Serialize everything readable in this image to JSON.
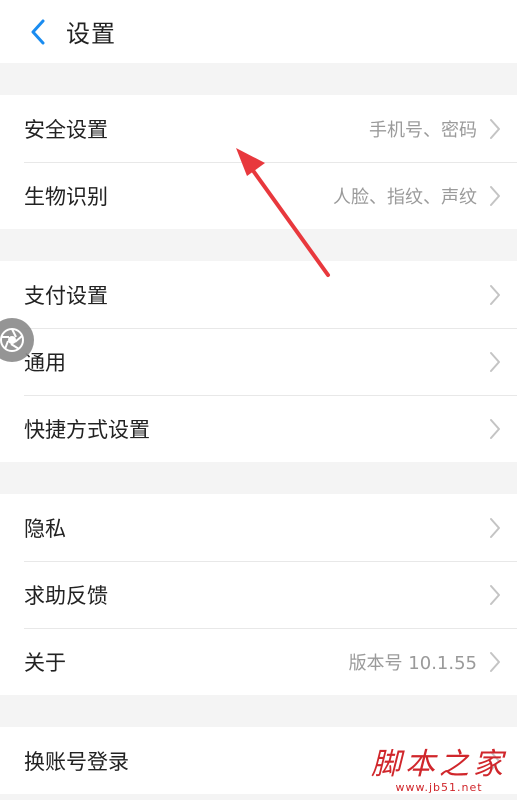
{
  "header": {
    "title": "设置"
  },
  "groups": [
    {
      "items": [
        {
          "label": "安全设置",
          "value": "手机号、密码"
        },
        {
          "label": "生物识别",
          "value": "人脸、指纹、声纹"
        }
      ]
    },
    {
      "items": [
        {
          "label": "支付设置",
          "value": ""
        },
        {
          "label": "通用",
          "value": ""
        },
        {
          "label": "快捷方式设置",
          "value": ""
        }
      ]
    },
    {
      "items": [
        {
          "label": "隐私",
          "value": ""
        },
        {
          "label": "求助反馈",
          "value": ""
        },
        {
          "label": "关于",
          "value": "版本号 10.1.55"
        }
      ]
    },
    {
      "items": [
        {
          "label": "换账号登录",
          "value": ""
        }
      ]
    }
  ],
  "watermark": {
    "main": "脚本之家",
    "sub": "www.jb51.net"
  },
  "colors": {
    "accent": "#1a8cf0",
    "annotation": "#e8383d",
    "background": "#f4f4f4"
  },
  "icons": {
    "back": "chevron-left-icon",
    "row": "chevron-right-icon",
    "floating": "shutter-icon"
  }
}
